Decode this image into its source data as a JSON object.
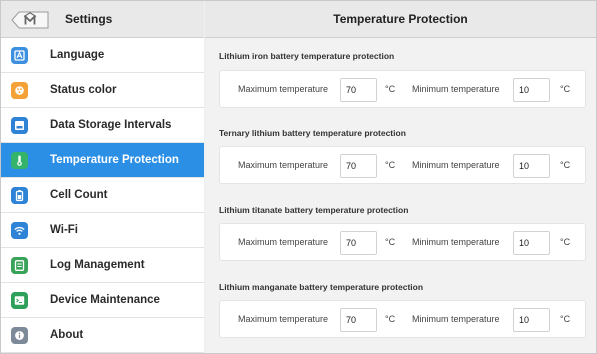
{
  "sidebar": {
    "title": "Settings",
    "items": [
      {
        "label": "Language",
        "icon": "language-icon",
        "color": "#3d8fe0"
      },
      {
        "label": "Status color",
        "icon": "palette-icon",
        "color": "#f4a237"
      },
      {
        "label": "Data Storage Intervals",
        "icon": "storage-icon",
        "color": "#2f83d6"
      },
      {
        "label": "Temperature Protection",
        "icon": "thermometer-icon",
        "color": "#34b36a",
        "active": true
      },
      {
        "label": "Cell Count",
        "icon": "battery-icon",
        "color": "#2f83d6"
      },
      {
        "label": "Wi-Fi",
        "icon": "wifi-icon",
        "color": "#2f83d6"
      },
      {
        "label": "Log Management",
        "icon": "log-icon",
        "color": "#3aa35a"
      },
      {
        "label": "Device Maintenance",
        "icon": "terminal-icon",
        "color": "#2fa05a"
      },
      {
        "label": "About",
        "icon": "info-icon",
        "color": "#7d8a99"
      }
    ]
  },
  "main": {
    "title": "Temperature Protection",
    "sections": [
      {
        "title": "Lithium iron  battery temperature protection",
        "max_label": "Maximum temperature",
        "max_value": "70",
        "max_unit": "°C",
        "min_label": "Minimum temperature",
        "min_value": "10",
        "min_unit": "°C"
      },
      {
        "title": "Ternary lithium  battery temperature protection",
        "max_label": "Maximum temperature",
        "max_value": "70",
        "max_unit": "°C",
        "min_label": "Minimum temperature",
        "min_value": "10",
        "min_unit": "°C"
      },
      {
        "title": "Lithium titanate  battery temperature protection",
        "max_label": "Maximum temperature",
        "max_value": "70",
        "max_unit": "°C",
        "min_label": "Minimum temperature",
        "min_value": "10",
        "min_unit": "°C"
      },
      {
        "title": "Lithium manganate  battery temperature protection",
        "max_label": "Maximum temperature",
        "max_value": "70",
        "max_unit": "°C",
        "min_label": "Minimum temperature",
        "min_value": "10",
        "min_unit": "°C"
      }
    ]
  },
  "colors": {
    "active_bg": "#2b8fe6",
    "header_bg": "#e9e9e9",
    "content_bg": "#f2f2f2"
  }
}
